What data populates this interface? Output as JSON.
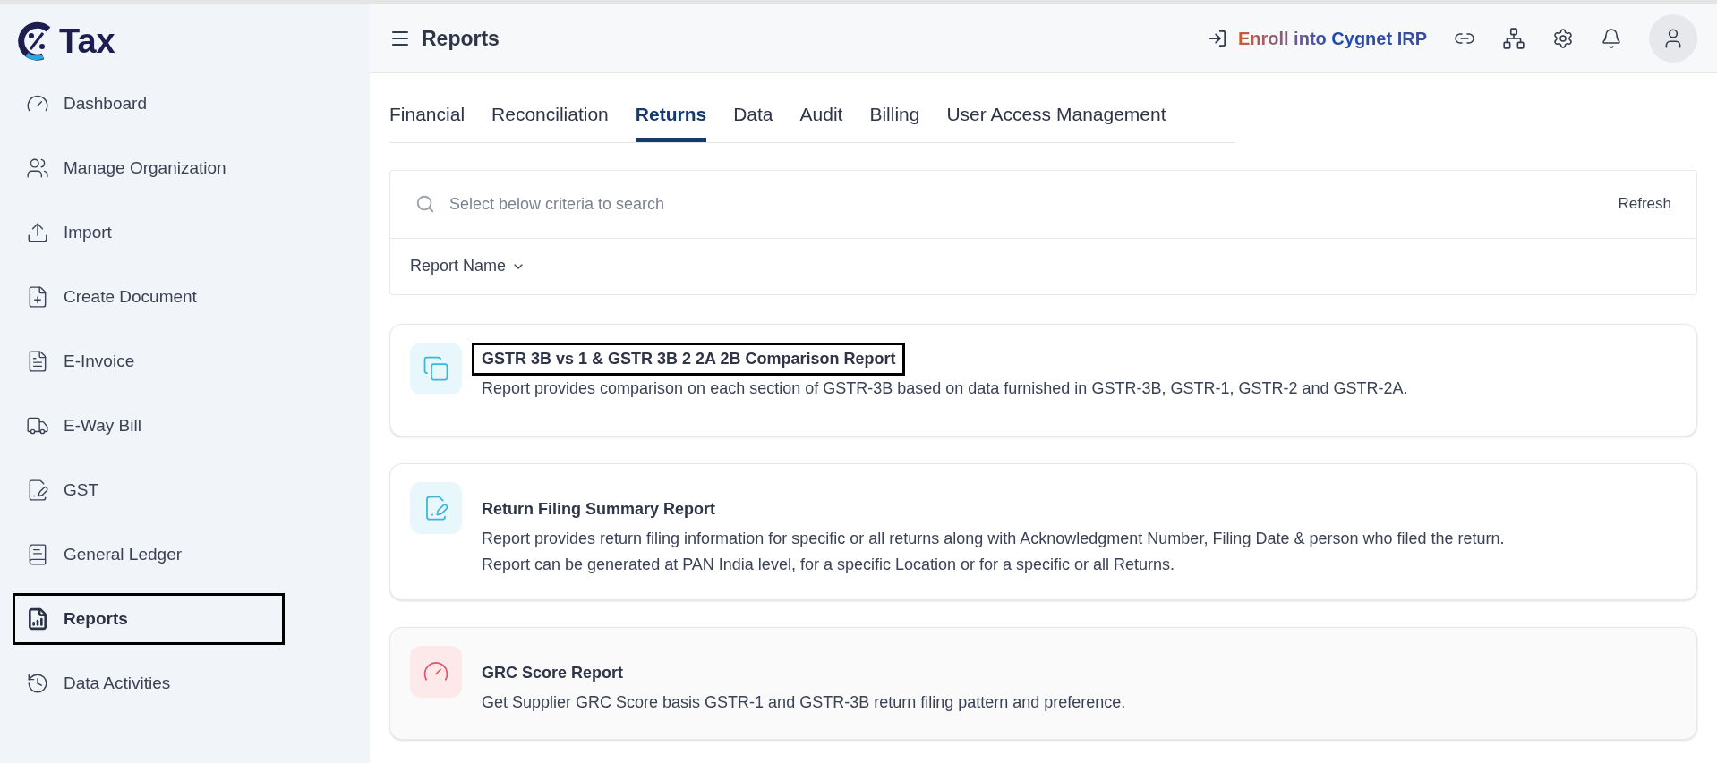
{
  "logo": {
    "text": "Tax"
  },
  "sidebar": {
    "items": [
      {
        "label": "Dashboard",
        "selected": false,
        "highlighted": false
      },
      {
        "label": "Manage Organization",
        "selected": false,
        "highlighted": false
      },
      {
        "label": "Import",
        "selected": false,
        "highlighted": false
      },
      {
        "label": "Create Document",
        "selected": false,
        "highlighted": false
      },
      {
        "label": "E-Invoice",
        "selected": false,
        "highlighted": false
      },
      {
        "label": "E-Way Bill",
        "selected": false,
        "highlighted": false
      },
      {
        "label": "GST",
        "selected": false,
        "highlighted": false
      },
      {
        "label": "General Ledger",
        "selected": false,
        "highlighted": false
      },
      {
        "label": "Reports",
        "selected": true,
        "highlighted": true
      },
      {
        "label": "Data Activities",
        "selected": false,
        "highlighted": false
      }
    ]
  },
  "header": {
    "title": "Reports",
    "enroll_link": "Enroll into Cygnet IRP"
  },
  "tabs": [
    {
      "label": "Financial",
      "selected": false
    },
    {
      "label": "Reconciliation",
      "selected": false
    },
    {
      "label": "Returns",
      "selected": true
    },
    {
      "label": "Data",
      "selected": false
    },
    {
      "label": "Audit",
      "selected": false
    },
    {
      "label": "Billing",
      "selected": false
    },
    {
      "label": "User Access Management",
      "selected": false
    }
  ],
  "search": {
    "placeholder": "Select below criteria to search",
    "refresh": "Refresh",
    "filter": "Report Name"
  },
  "reports": [
    {
      "title": "GSTR 3B vs 1 & GSTR 3B 2 2A 2B Comparison Report",
      "description": [
        "Report provides comparison on each section of GSTR-3B based on data furnished in GSTR-3B, GSTR-1, GSTR-2 and GSTR-2A."
      ],
      "highlighted": true
    },
    {
      "title": "Return Filing Summary Report",
      "description": [
        "Report provides return filing information for specific or all returns along with Acknowledgment Number, Filing Date & person who filed the return.",
        "Report can be generated at PAN India level, for a specific Location or for a specific or all Returns."
      ],
      "highlighted": false
    },
    {
      "title": "GRC Score Report",
      "description": [
        "Get Supplier GRC Score basis GSTR-1 and GSTR-3B return filing pattern and preference."
      ],
      "highlighted": false
    }
  ]
}
